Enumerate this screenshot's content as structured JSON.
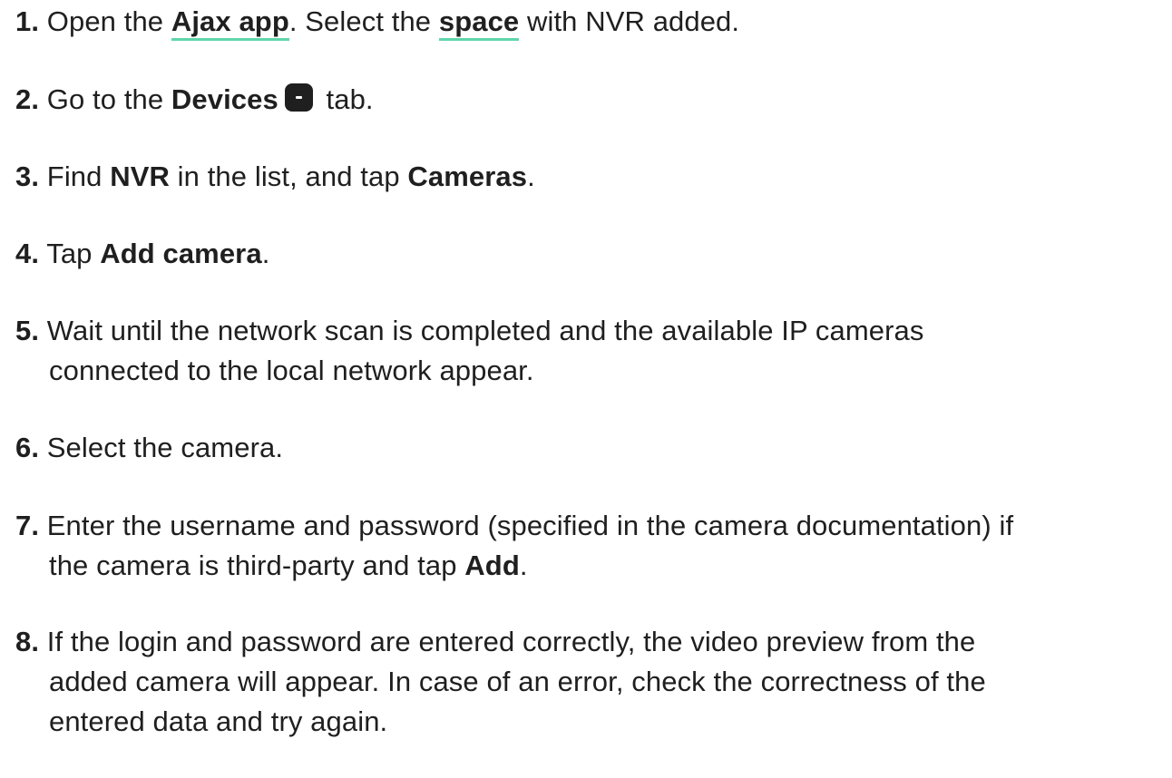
{
  "steps": [
    {
      "num": "1.",
      "t1": "Open the ",
      "link1": "Ajax app",
      "t2": ". Select the ",
      "link2": "space",
      "t3": " with NVR added."
    },
    {
      "num": "2.",
      "t1": "Go to the ",
      "b1": "Devices",
      "icon": "devices-tab-icon",
      "t2": " tab."
    },
    {
      "num": "3.",
      "t1": "Find ",
      "b1": "NVR",
      "t2": " in the list, and tap ",
      "b2": "Cameras",
      "t3": "."
    },
    {
      "num": "4.",
      "t1": "Tap ",
      "b1": "Add camera",
      "t2": "."
    },
    {
      "num": "5.",
      "line1": "Wait until the network scan is completed and the available IP cameras",
      "line2": "connected to the local network appear."
    },
    {
      "num": "6.",
      "t1": "Select the camera."
    },
    {
      "num": "7.",
      "line1": "Enter the username and password (specified in the camera documentation) if",
      "line2a": "the camera is third-party and tap ",
      "b1": "Add",
      "line2b": "."
    },
    {
      "num": "8.",
      "line1": "If the login and password are entered correctly, the video preview from the",
      "line2": "added camera will appear. In case of an error, check the correctness of the",
      "line3": "entered data and try again."
    }
  ],
  "colors": {
    "text": "#1f1f1f",
    "link_underline": "#5fd6a9"
  }
}
